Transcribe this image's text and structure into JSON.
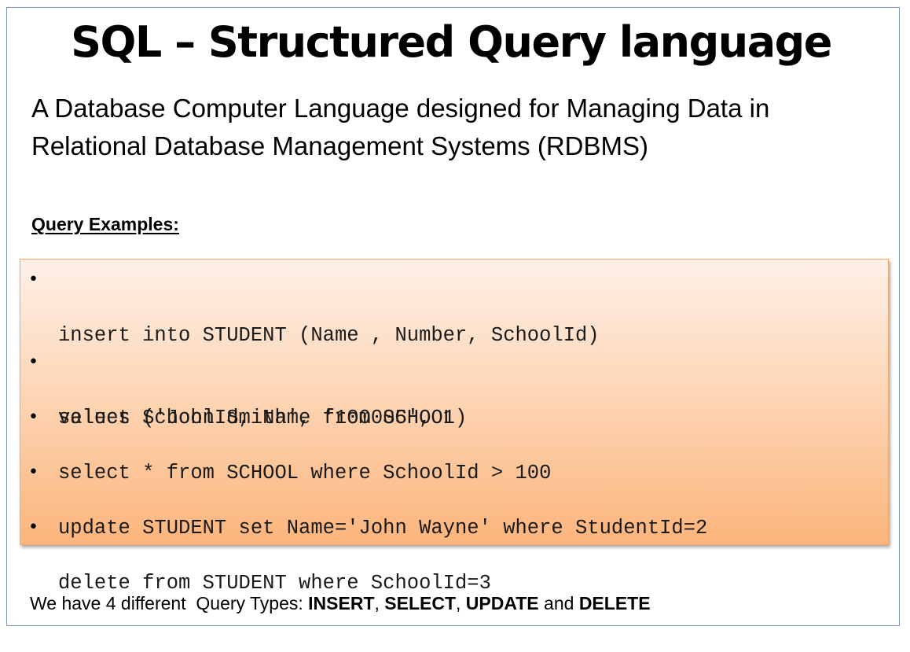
{
  "title": "SQL – Structured Query language",
  "subtitle": {
    "line1": "A Database Computer Language designed for Managing Data in",
    "line2": "Relational Database Management Systems (RDBMS)"
  },
  "section_heading": "Query Examples:",
  "queries": [
    {
      "bullet": "•",
      "line1": "insert into STUDENT (Name , Number, SchoolId)",
      "line2": "values ('John Smith', '100005', 1)"
    },
    {
      "bullet": "•",
      "line1": "select SchoolId, Name from SCHOOL"
    },
    {
      "bullet": "•",
      "line1": "select * from SCHOOL where SchoolId > 100"
    },
    {
      "bullet": "•",
      "line1": "update STUDENT set Name='John Wayne' where StudentId=2"
    },
    {
      "bullet": "•",
      "line1": "delete from STUDENT where SchoolId=3"
    }
  ],
  "footer": {
    "prefix": "We have 4 different  Query Types: ",
    "type1": "INSERT",
    "sep1": ", ",
    "type2": "SELECT",
    "sep2": ", ",
    "type3": "UPDATE",
    "sep3": " and ",
    "type4": "DELETE"
  },
  "colors": {
    "frame_border": "#7f95c6",
    "box_top": "#fef0e8",
    "box_bottom": "#fcb57c",
    "box_border": "#f5a868"
  }
}
